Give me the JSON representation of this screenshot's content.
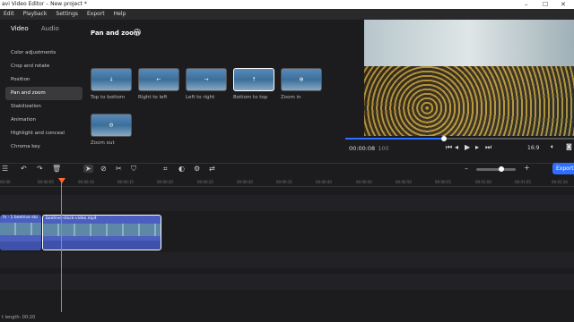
{
  "titlebar": {
    "title": "avi Video Editor – New project *",
    "min": "–",
    "max": "☐",
    "close": "✕"
  },
  "menu": [
    "Edit",
    "Playback",
    "Settings",
    "Export",
    "Help"
  ],
  "tabs": [
    "Video",
    "Audio"
  ],
  "sidebar": [
    "Color adjustments",
    "Crop and rotate",
    "Position",
    "Pan and zoom",
    "Stabilization",
    "Animation",
    "Highlight and conceal",
    "Chroma key"
  ],
  "panzoom": {
    "title": "Pan and zoom",
    "help": "?",
    "presets": [
      "Top to bottom",
      "Right to left",
      "Left to right",
      "Bottom to top",
      "Zoom in",
      "Zoom out"
    ]
  },
  "player": {
    "time": "00:00:08",
    "frames": "100",
    "aspect": "16:9",
    "progress": 0.43
  },
  "toolbar": {
    "export": "Export",
    "zoom_minus": "–",
    "zoom_plus": "+"
  },
  "ruler": [
    "00:00",
    "00:00:05",
    "00:00:10",
    "00:00:15",
    "00:00:20",
    "00:00:25",
    "00:00:30",
    "00:00:35",
    "00:00:40",
    "00:00:45",
    "00:00:50",
    "00:00:55",
    "00:01:00",
    "00:01:05",
    "00:01:10"
  ],
  "clips": {
    "clip1": "fx · 1 beehive sto",
    "clip2": "beehive-stock-video.mp4"
  },
  "status": {
    "length": "t length: 00:20"
  }
}
